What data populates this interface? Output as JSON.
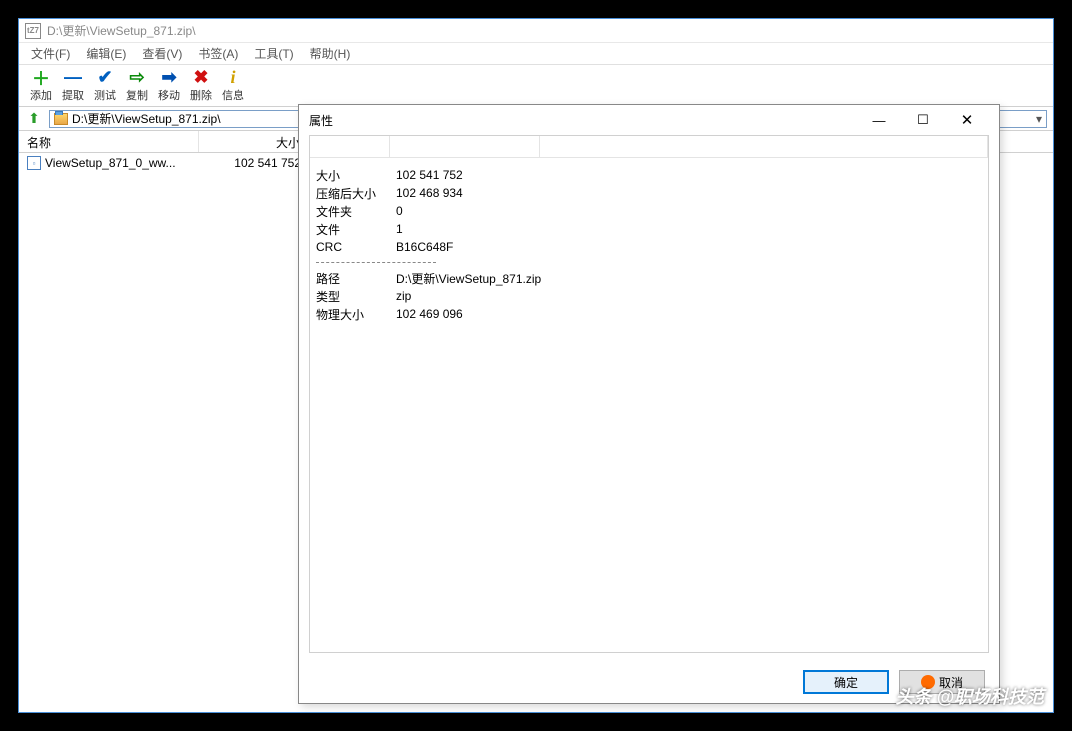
{
  "window": {
    "title": "D:\\更新\\ViewSetup_871.zip\\",
    "icon_label": "tZ7"
  },
  "menu": {
    "file": "文件(F)",
    "edit": "编辑(E)",
    "view": "查看(V)",
    "bookmarks": "书签(A)",
    "tools": "工具(T)",
    "help": "帮助(H)"
  },
  "toolbar": {
    "add": "添加",
    "extract": "提取",
    "test": "测试",
    "copy": "复制",
    "move": "移动",
    "delete": "删除",
    "info": "信息"
  },
  "address": {
    "path": "D:\\更新\\ViewSetup_871.zip\\"
  },
  "columns": {
    "name": "名称",
    "size": "大小"
  },
  "rows": [
    {
      "name": "ViewSetup_871_0_ww...",
      "size": "102 541 752"
    }
  ],
  "dialog": {
    "title": "属性",
    "labels": {
      "size": "大小",
      "packed": "压缩后大小",
      "folders": "文件夹",
      "files": "文件",
      "crc": "CRC",
      "path": "路径",
      "type": "类型",
      "physical": "物理大小"
    },
    "values": {
      "size": "102 541 752",
      "packed": "102 468 934",
      "folders": "0",
      "files": "1",
      "crc": "B16C648F",
      "path": "D:\\更新\\ViewSetup_871.zip",
      "type": "zip",
      "physical": "102 469 096"
    },
    "buttons": {
      "ok": "确定",
      "cancel": "取消"
    }
  },
  "watermark": "头条 @职场科技范"
}
